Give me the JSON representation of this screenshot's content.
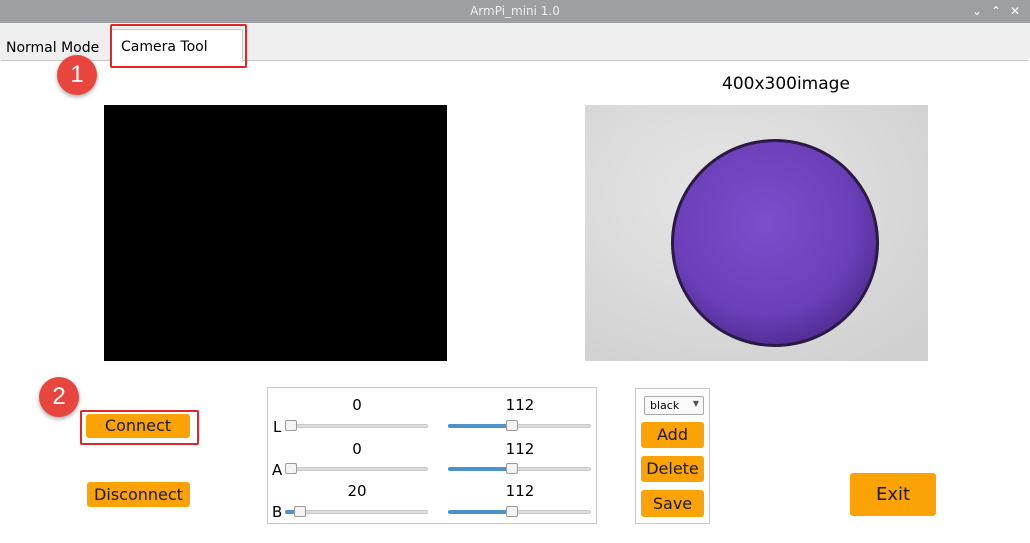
{
  "window": {
    "title": "ArmPi_mini 1.0",
    "controls": [
      "⌄",
      "⌃",
      "✕"
    ]
  },
  "tabs": [
    {
      "label": "Normal Mode"
    },
    {
      "label": "Camera Tool"
    }
  ],
  "annotations": {
    "step1": "1",
    "step2": "2"
  },
  "preview": {
    "title": "400x300image"
  },
  "buttons": {
    "connect": "Connect",
    "disconnect": "Disconnect",
    "add": "Add",
    "delete": "Delete",
    "save": "Save",
    "exit": "Exit"
  },
  "sliders": {
    "L": {
      "label": "L",
      "min_value": "0",
      "max_value": "112",
      "min_fraction": 0,
      "max_fraction": 0.44
    },
    "A": {
      "label": "A",
      "min_value": "0",
      "max_value": "112",
      "min_fraction": 0,
      "max_fraction": 0.44
    },
    "B": {
      "label": "B",
      "min_value": "20",
      "max_value": "112",
      "min_fraction": 0.08,
      "max_fraction": 0.44
    }
  },
  "color_select": {
    "selected": "black"
  },
  "colors": {
    "accent_orange": "#fba205",
    "highlight_red": "#e0262a",
    "slider_blue": "#4d93c9",
    "ball_purple": "#6a3fb8"
  }
}
